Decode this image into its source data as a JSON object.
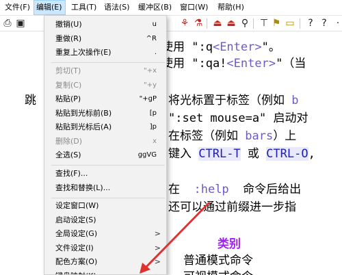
{
  "menubar": {
    "items": [
      {
        "label": "文件(F)"
      },
      {
        "label": "编辑(E)"
      },
      {
        "label": "工具(T)"
      },
      {
        "label": "语法(S)"
      },
      {
        "label": "缓冲区(B)"
      },
      {
        "label": "窗口(W)"
      },
      {
        "label": "帮助(H)"
      }
    ]
  },
  "edit_menu": {
    "items": [
      {
        "label": "撤销(U)",
        "shortcut": "u",
        "enabled": true
      },
      {
        "label": "重做(R)",
        "shortcut": "^R",
        "enabled": true
      },
      {
        "label": "重复上次操作(E)",
        "shortcut": ".",
        "enabled": true
      },
      {
        "label": "剪切(T)",
        "shortcut": "\"+x",
        "enabled": false
      },
      {
        "label": "复制(C)",
        "shortcut": "\"+y",
        "enabled": false
      },
      {
        "label": "粘贴(P)",
        "shortcut": "\"+gP",
        "enabled": true
      },
      {
        "label": "粘贴到光标前(B)",
        "shortcut": "[p",
        "enabled": true
      },
      {
        "label": "粘贴到光标后(A)",
        "shortcut": "]p",
        "enabled": true
      },
      {
        "label": "删除(D)",
        "shortcut": "x",
        "enabled": false
      },
      {
        "label": "全选(S)",
        "shortcut": "ggVG",
        "enabled": true
      },
      {
        "label": "查找(F)...",
        "shortcut": "",
        "enabled": true
      },
      {
        "label": "查找和替换(L)...",
        "shortcut": "",
        "enabled": true
      },
      {
        "label": "设定窗口(W)",
        "shortcut": "",
        "enabled": true
      },
      {
        "label": "启动设定(S)",
        "shortcut": "",
        "enabled": true
      },
      {
        "label": "全局设定(G)",
        "shortcut": "",
        "enabled": true,
        "submenu": true
      },
      {
        "label": "文件设定(I)",
        "shortcut": "",
        "enabled": true,
        "submenu": true
      },
      {
        "label": "配色方案(O)",
        "shortcut": "",
        "enabled": true,
        "submenu": true
      },
      {
        "label": "键盘映射(K)",
        "shortcut": "",
        "enabled": true,
        "submenu": true
      }
    ],
    "submenu_arrow": ">"
  },
  "editor": {
    "lines": {
      "l1a": "使用 \":q",
      "l1b": "<Enter>",
      "l1c": "\"。",
      "l2a": "使用 \":qa!",
      "l2b": "<Enter>",
      "l2c": "\"（当",
      "l3a": "将光标置于标签（例如",
      "l3b": "b",
      "l3left": "跳",
      "l4a": "\":set mouse=a\" 启动对",
      "l5a": "在标签（例如",
      "l5b": "bars",
      "l5c": "）上",
      "l6a": "键入",
      "l6b": "CTRL-T",
      "l6c": "或",
      "l6d": "CTRL-O",
      "l6e": ",",
      "l7a": "在",
      "l7b": ":help",
      "l7c": "命令后给出",
      "l8a": "还可以通过前缀进一步指",
      "l9": "类别",
      "l10": "普通模式命令",
      "l11": "可视模式命令"
    }
  },
  "colors": {
    "highlight": "#6a5acd",
    "keyword": "#1d1db8",
    "heading": "#a020f0",
    "arrow": "#e03030",
    "menu_bg": "#f2f2f2",
    "menubar_active": "#cce8ff"
  },
  "toolbar": {
    "icons": [
      "print-icon",
      "save-icon",
      "find-replace-icon",
      "find-next-icon",
      "load-session-icon",
      "save-session-icon",
      "run-script-icon",
      "make-icon",
      "find-tag-icon",
      "help-icon",
      "find-help-icon",
      "question-icon"
    ]
  }
}
